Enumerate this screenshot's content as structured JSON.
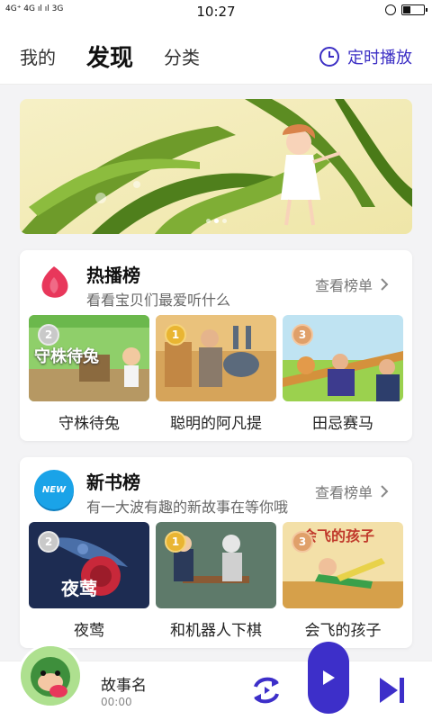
{
  "status": {
    "network": "4G⁺ 4G ıl ıl 3G",
    "time": "10:27"
  },
  "nav": {
    "tabs": [
      {
        "label": "我的"
      },
      {
        "label": "发现"
      },
      {
        "label": "分类"
      }
    ],
    "timer_label": "定时播放"
  },
  "hot": {
    "title": "热播榜",
    "subtitle": "看看宝贝们最爱听什么",
    "more": "查看榜单",
    "books": [
      {
        "title": "守株待兔",
        "rank": "2",
        "cover_text": "守株待兔"
      },
      {
        "title": "聪明的阿凡提",
        "rank": "1"
      },
      {
        "title": "田忌赛马",
        "rank": "3"
      }
    ]
  },
  "new": {
    "title": "新书榜",
    "badge": "NEW",
    "subtitle": "有一大波有趣的新故事在等你哦",
    "more": "查看榜单",
    "books": [
      {
        "title": "夜莺",
        "rank": "2",
        "cover_text": "夜莺"
      },
      {
        "title": "和机器人下棋",
        "rank": "1"
      },
      {
        "title": "会飞的孩子",
        "rank": "3",
        "cover_text": "会飞的孩子"
      }
    ]
  },
  "player": {
    "title": "故事名",
    "time": "00:00"
  },
  "colors": {
    "accent": "#3d2fc9",
    "hot_icon": "#e8375b",
    "new_badge": "#1aa3e8"
  }
}
